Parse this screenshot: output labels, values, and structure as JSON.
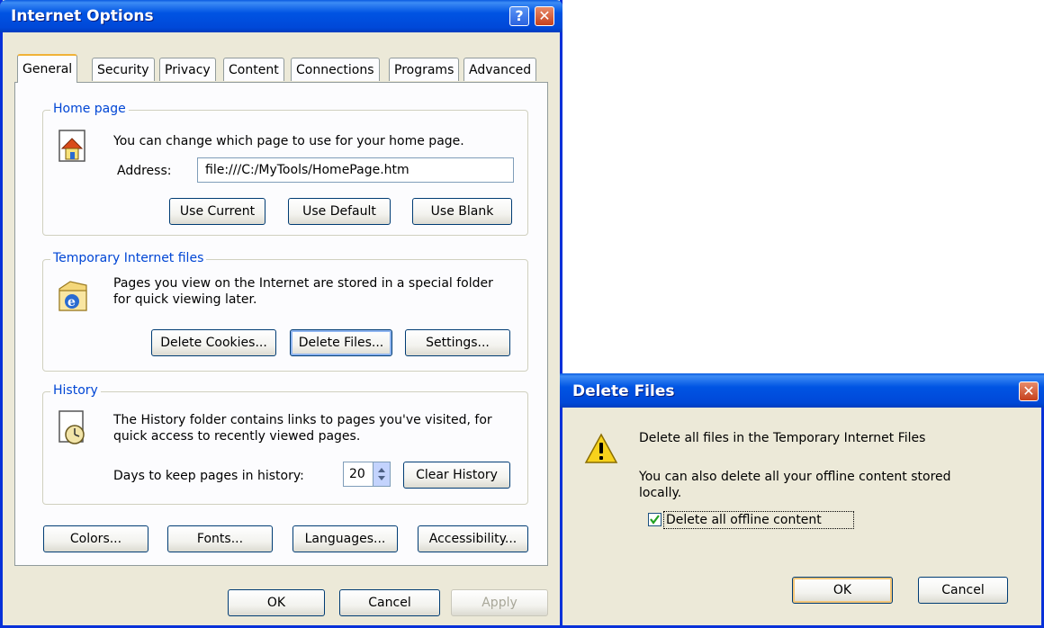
{
  "internet_options": {
    "title": "Internet Options",
    "tabs": [
      {
        "label": "General"
      },
      {
        "label": "Security"
      },
      {
        "label": "Privacy"
      },
      {
        "label": "Content"
      },
      {
        "label": "Connections"
      },
      {
        "label": "Programs"
      },
      {
        "label": "Advanced"
      }
    ],
    "home_page": {
      "legend": "Home page",
      "description": "You can change which page to use for your home page.",
      "address_label": "Address:",
      "address_value": "file:///C:/MyTools/HomePage.htm",
      "use_current": "Use Current",
      "use_default": "Use Default",
      "use_blank": "Use Blank"
    },
    "temp_files": {
      "legend": "Temporary Internet files",
      "description_line1": "Pages you view on the Internet are stored in a special folder",
      "description_line2": "for quick viewing later.",
      "delete_cookies": "Delete Cookies...",
      "delete_files": "Delete Files...",
      "settings": "Settings..."
    },
    "history": {
      "legend": "History",
      "description_line1": "The History folder contains links to pages you've visited, for",
      "description_line2": "quick access to recently viewed pages.",
      "days_label": "Days to keep pages in history:",
      "days_value": "20",
      "clear_history": "Clear History"
    },
    "bottom_buttons": {
      "colors": "Colors...",
      "fonts": "Fonts...",
      "languages": "Languages...",
      "accessibility": "Accessibility..."
    },
    "dialog_buttons": {
      "ok": "OK",
      "cancel": "Cancel",
      "apply": "Apply"
    }
  },
  "delete_files": {
    "title": "Delete Files",
    "message_line1": "Delete all files in the Temporary Internet Files",
    "message_line2": "You can also delete all your offline content stored",
    "message_line3": "locally.",
    "checkbox_label": "Delete all offline content",
    "checkbox_checked": true,
    "ok": "OK",
    "cancel": "Cancel"
  },
  "colors": {
    "titlebar": "#0054e3",
    "window_face": "#ece9d8",
    "groupbox_legend": "#0046d5",
    "close_button": "#c5401c"
  }
}
